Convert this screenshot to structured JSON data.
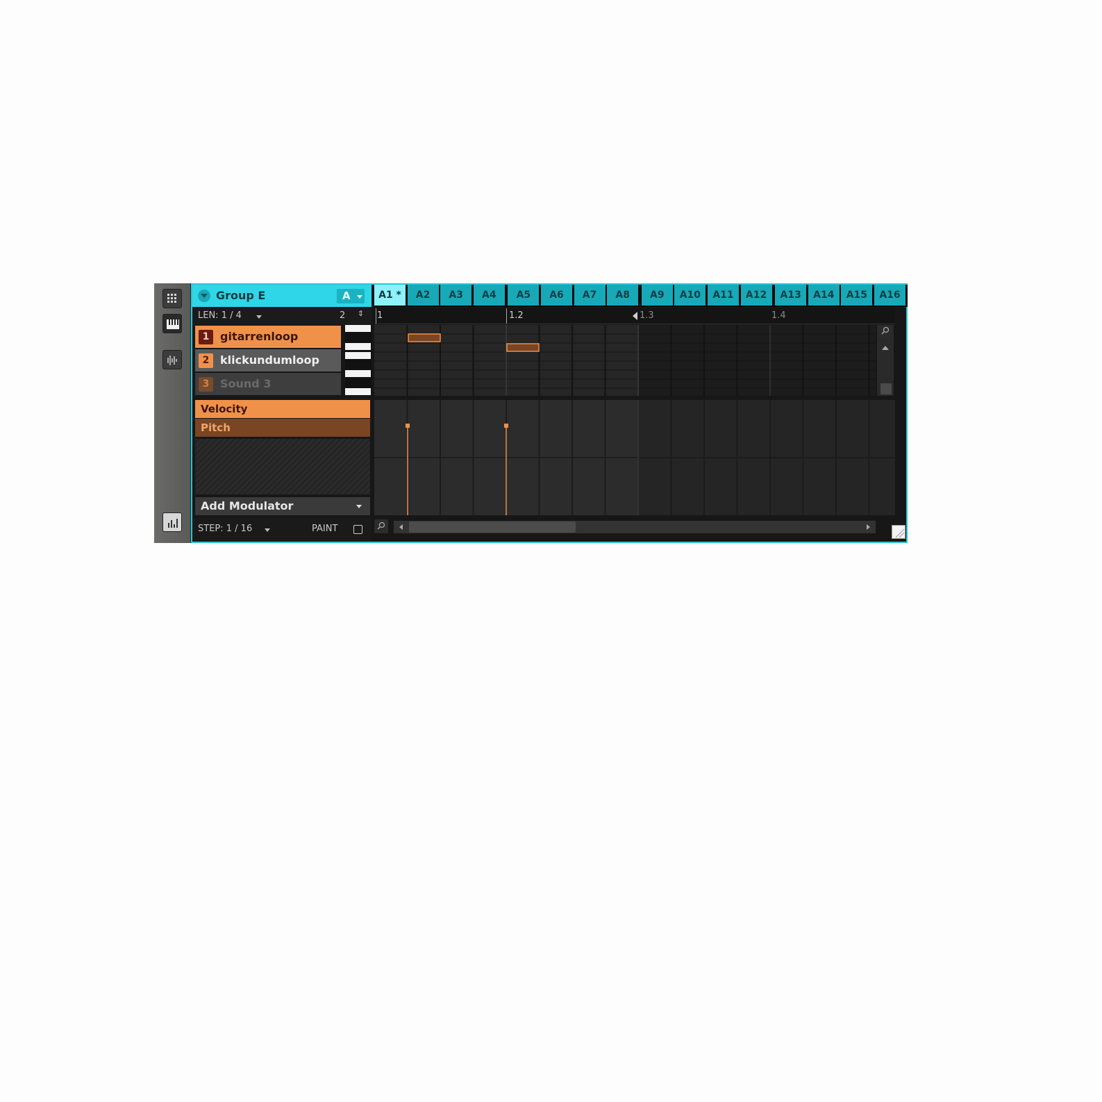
{
  "group": {
    "title": "Group E",
    "bank": "A"
  },
  "patterns": [
    "A1 *",
    "A2",
    "A3",
    "A4",
    "A5",
    "A6",
    "A7",
    "A8",
    "A9",
    "A10",
    "A11",
    "A12",
    "A13",
    "A14",
    "A15",
    "A16"
  ],
  "length": {
    "label": "LEN: 1 / 4",
    "zoom": "2"
  },
  "sounds": [
    {
      "num": "1",
      "name": "gitarrenloop"
    },
    {
      "num": "2",
      "name": "klickundumloop"
    },
    {
      "num": "3",
      "name": "Sound 3"
    }
  ],
  "lanes": {
    "velocity": "Velocity",
    "pitch": "Pitch"
  },
  "add_modulator": "Add Modulator",
  "step": {
    "label": "STEP: 1 / 16",
    "paint": "PAINT"
  },
  "ruler": [
    "1",
    "1.2",
    "1.3",
    "1.4"
  ],
  "colors": {
    "accent": "#2fd6e8",
    "orange": "#f0914a"
  },
  "icons": [
    "grid-icon",
    "keyboard-icon",
    "waveform-icon",
    "control-lane-icon",
    "zoom-icon"
  ]
}
